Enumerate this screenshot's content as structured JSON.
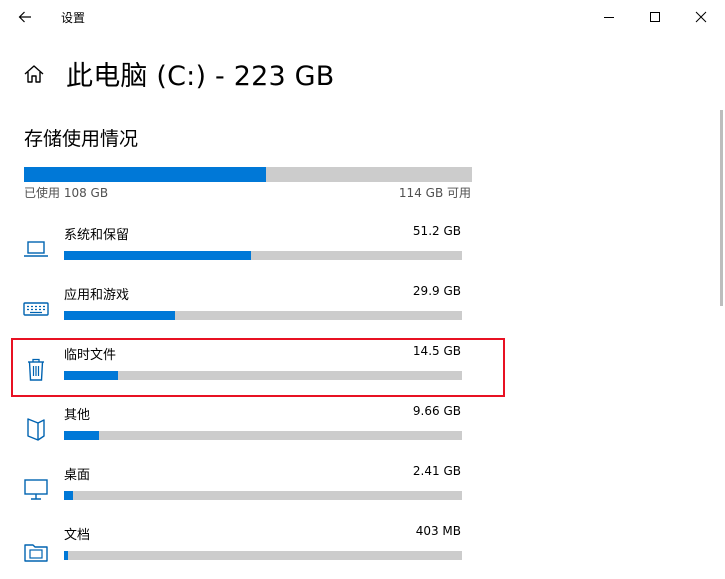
{
  "window": {
    "title": "设置"
  },
  "page": {
    "title": "此电脑 (C:) - 223 GB",
    "section_title": "存储使用情况"
  },
  "storage": {
    "used_label": "已使用 108 GB",
    "free_label": "114 GB 可用",
    "used_fraction": 0.486
  },
  "categories": [
    {
      "name": "系统和保留",
      "size": "51.2 GB",
      "fraction": 0.47,
      "icon": "laptop-icon"
    },
    {
      "name": "应用和游戏",
      "size": "29.9 GB",
      "fraction": 0.28,
      "icon": "keyboard-icon"
    },
    {
      "name": "临时文件",
      "size": "14.5 GB",
      "fraction": 0.135,
      "icon": "trash-icon",
      "highlighted": true
    },
    {
      "name": "其他",
      "size": "9.66 GB",
      "fraction": 0.088,
      "icon": "other-files-icon"
    },
    {
      "name": "桌面",
      "size": "2.41 GB",
      "fraction": 0.022,
      "icon": "monitor-icon"
    },
    {
      "name": "文档",
      "size": "403 MB",
      "fraction": 0.004,
      "icon": "documents-icon"
    }
  ],
  "colors": {
    "accent": "#0078d7",
    "track": "#cccccc",
    "highlight": "#e81123"
  }
}
